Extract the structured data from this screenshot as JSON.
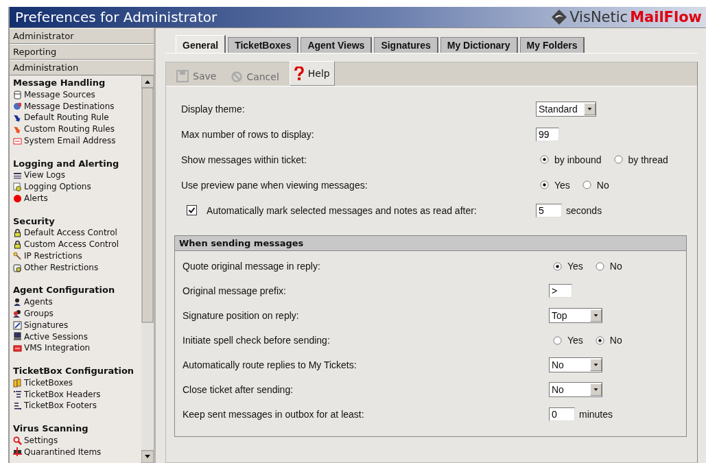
{
  "window": {
    "title": "Preferences for Administrator"
  },
  "brand": {
    "name": "VisNetic",
    "product": "MailFlow"
  },
  "sidebar": {
    "panels": [
      {
        "label": "Administrator"
      },
      {
        "label": "Reporting"
      },
      {
        "label": "Administration"
      }
    ],
    "sections": [
      {
        "title": "Message Handling",
        "items": [
          "Message Sources",
          "Message Destinations",
          "Default Routing Rule",
          "Custom Routing Rules",
          "System Email Address"
        ]
      },
      {
        "title": "Logging and Alerting",
        "items": [
          "View Logs",
          "Logging Options",
          "Alerts"
        ]
      },
      {
        "title": "Security",
        "items": [
          "Default Access Control",
          "Custom Access Control",
          "IP Restrictions",
          "Other Restrictions"
        ]
      },
      {
        "title": "Agent Configuration",
        "items": [
          "Agents",
          "Groups",
          "Signatures",
          "Active Sessions",
          "VMS Integration"
        ]
      },
      {
        "title": "TicketBox Configuration",
        "items": [
          "TicketBoxes",
          "TicketBox Headers",
          "TicketBox Footers"
        ]
      },
      {
        "title": "Virus Scanning",
        "items": [
          "Settings",
          "Quarantined Items"
        ]
      }
    ]
  },
  "tabs": [
    {
      "label": "General",
      "selected": true
    },
    {
      "label": "TicketBoxes",
      "selected": false
    },
    {
      "label": "Agent Views",
      "selected": false
    },
    {
      "label": "Signatures",
      "selected": false
    },
    {
      "label": "My Dictionary",
      "selected": false
    },
    {
      "label": "My Folders",
      "selected": false
    }
  ],
  "toolbar": {
    "buttons": [
      {
        "label": "Save",
        "disabled": true
      },
      {
        "label": "Cancel",
        "disabled": true
      },
      {
        "label": "Help",
        "disabled": false
      }
    ]
  },
  "general": {
    "rows": [
      {
        "kind": "select",
        "label": "Display theme:",
        "value": "Standard"
      },
      {
        "kind": "text",
        "label": "Max number of rows to display:",
        "value": "99"
      },
      {
        "kind": "radio",
        "label": "Show messages within ticket:",
        "options": [
          {
            "label": "by inbound",
            "selected": true
          },
          {
            "label": "by thread",
            "selected": false
          }
        ]
      },
      {
        "kind": "radio",
        "label": "Use preview pane when viewing messages:",
        "options": [
          {
            "label": "Yes",
            "selected": true
          },
          {
            "label": "No",
            "selected": false
          }
        ]
      },
      {
        "kind": "checkbox",
        "label": "Automatically mark selected messages and notes as read after:",
        "checked": true,
        "value": "5",
        "suffix": "seconds"
      }
    ]
  },
  "sending": {
    "title": "When sending messages",
    "rows": [
      {
        "kind": "radio",
        "label": "Quote original message in reply:",
        "options": [
          {
            "label": "Yes",
            "selected": true
          },
          {
            "label": "No",
            "selected": false
          }
        ]
      },
      {
        "kind": "text",
        "label": "Original message prefix:",
        "value": ">"
      },
      {
        "kind": "select",
        "label": "Signature position on reply:",
        "value": "Top"
      },
      {
        "kind": "radio",
        "label": "Initiate spell check before sending:",
        "options": [
          {
            "label": "Yes",
            "selected": false
          },
          {
            "label": "No",
            "selected": true
          }
        ]
      },
      {
        "kind": "select",
        "label": "Automatically route replies to My Tickets:",
        "value": "No"
      },
      {
        "kind": "select",
        "label": "Close ticket after sending:",
        "value": "No"
      },
      {
        "kind": "text",
        "label": "Keep sent messages in outbox for at least:",
        "value": "0",
        "suffix": "minutes"
      }
    ]
  }
}
